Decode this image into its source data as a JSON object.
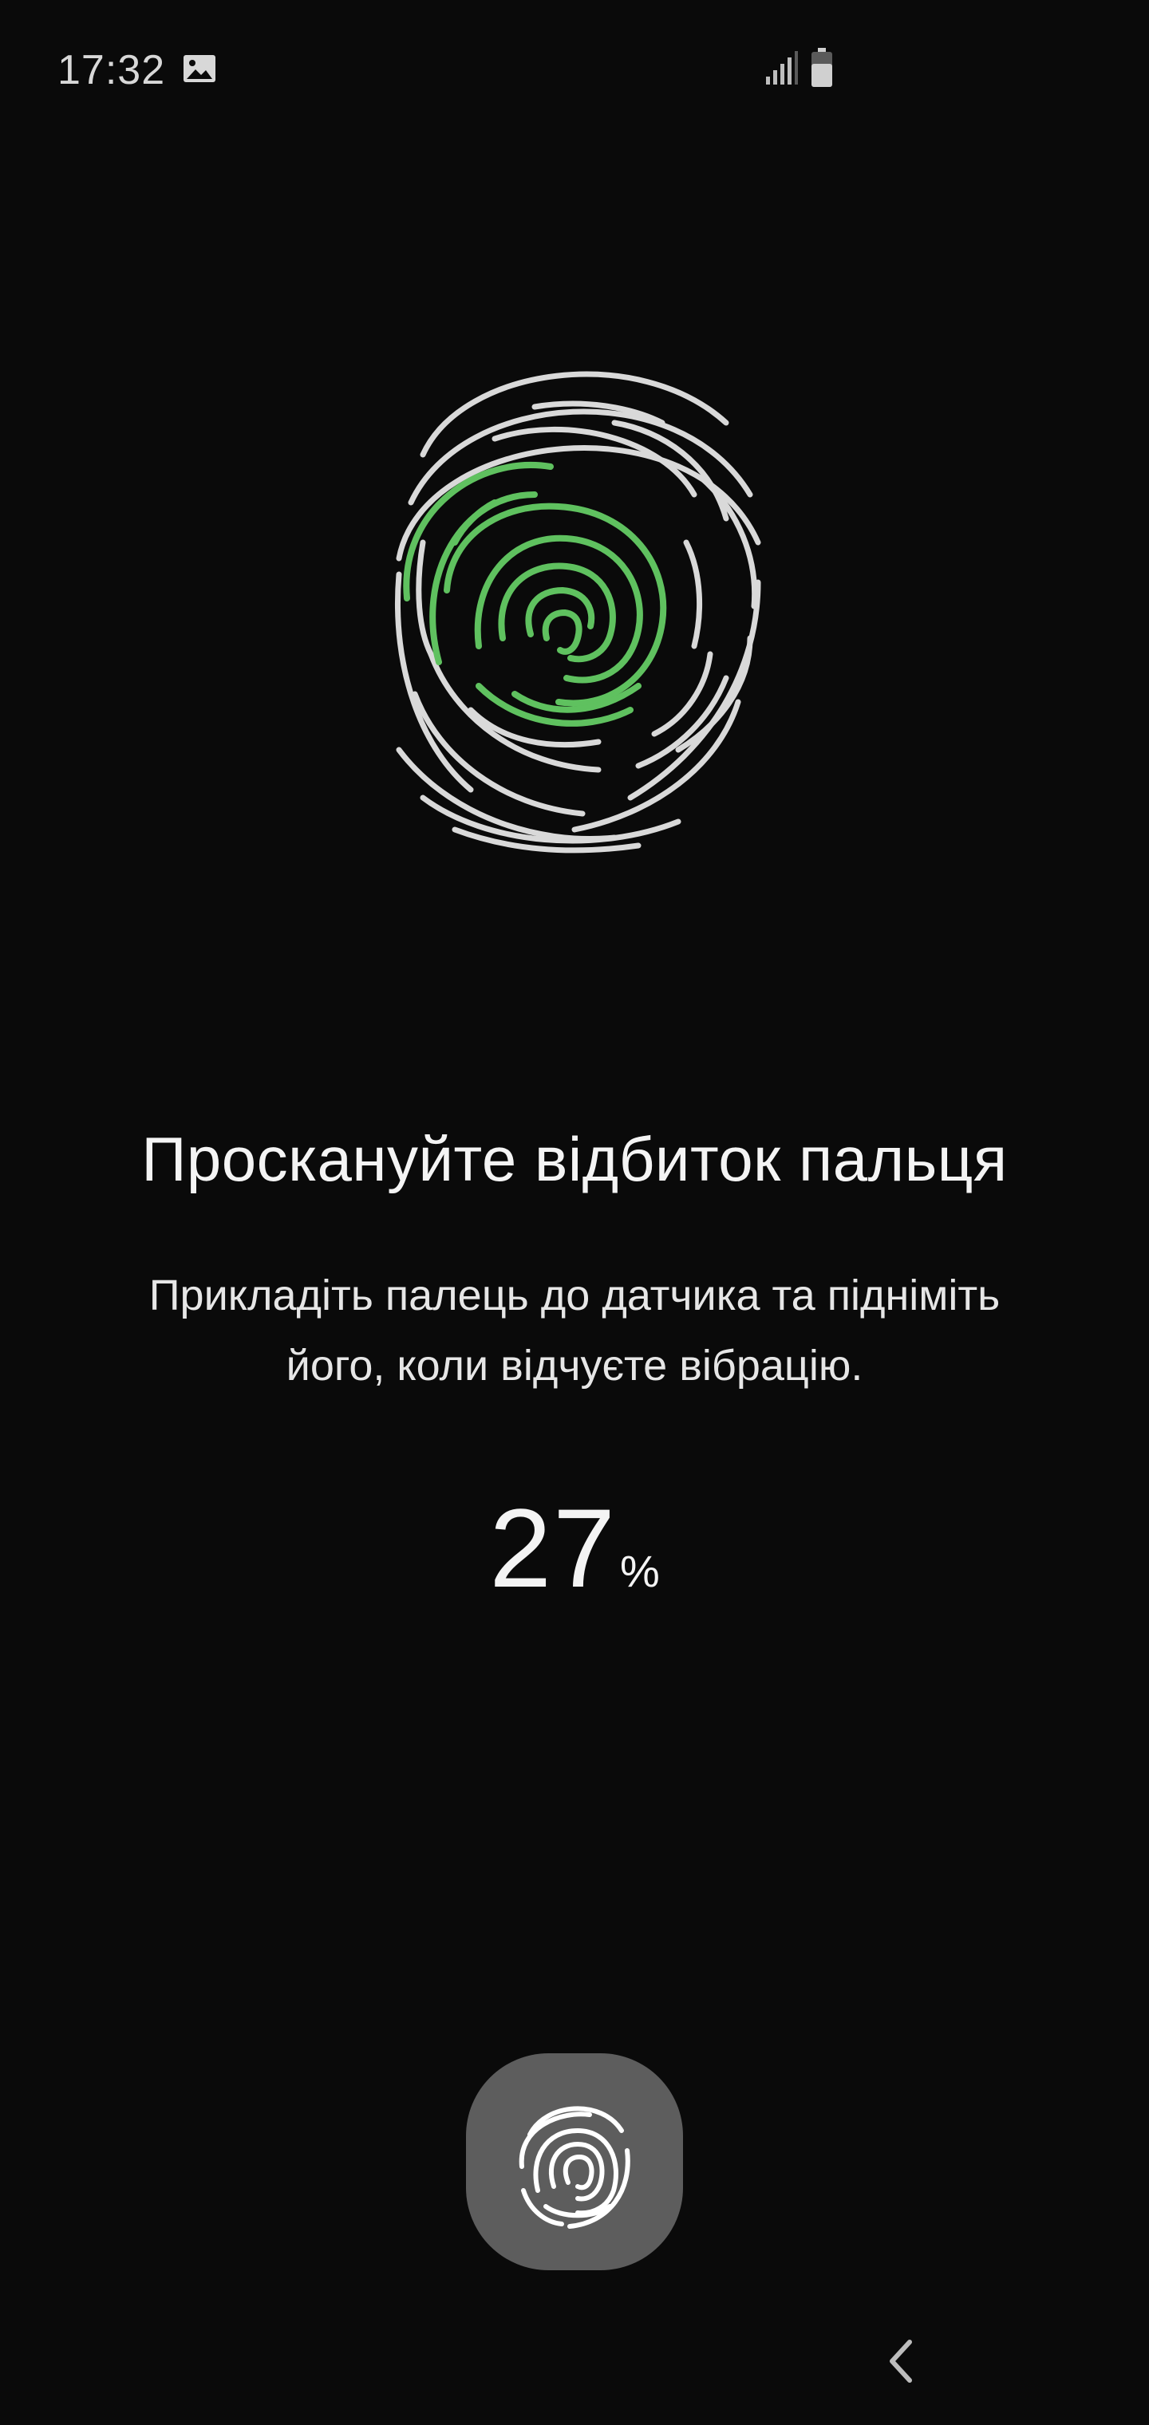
{
  "status_bar": {
    "time": "17:32",
    "icons": [
      "gallery-icon",
      "signal-icon",
      "battery-icon"
    ]
  },
  "main": {
    "title": "Проскануйте відбиток пальця",
    "instruction_line1": "Прикладіть палець до датчика та підніміть",
    "instruction_line2": "його, коли відчуєте вібрацію.",
    "progress_value": "27",
    "progress_unit": "%"
  },
  "sensor_button": {
    "icon": "fingerprint-icon"
  },
  "navigation": {
    "back_icon": "chevron-left-icon"
  },
  "colors": {
    "background": "#0a0a0a",
    "accent_green": "#5fc15f",
    "print_gray": "#d9d9d9",
    "button_gray": "#5d5d5d"
  }
}
